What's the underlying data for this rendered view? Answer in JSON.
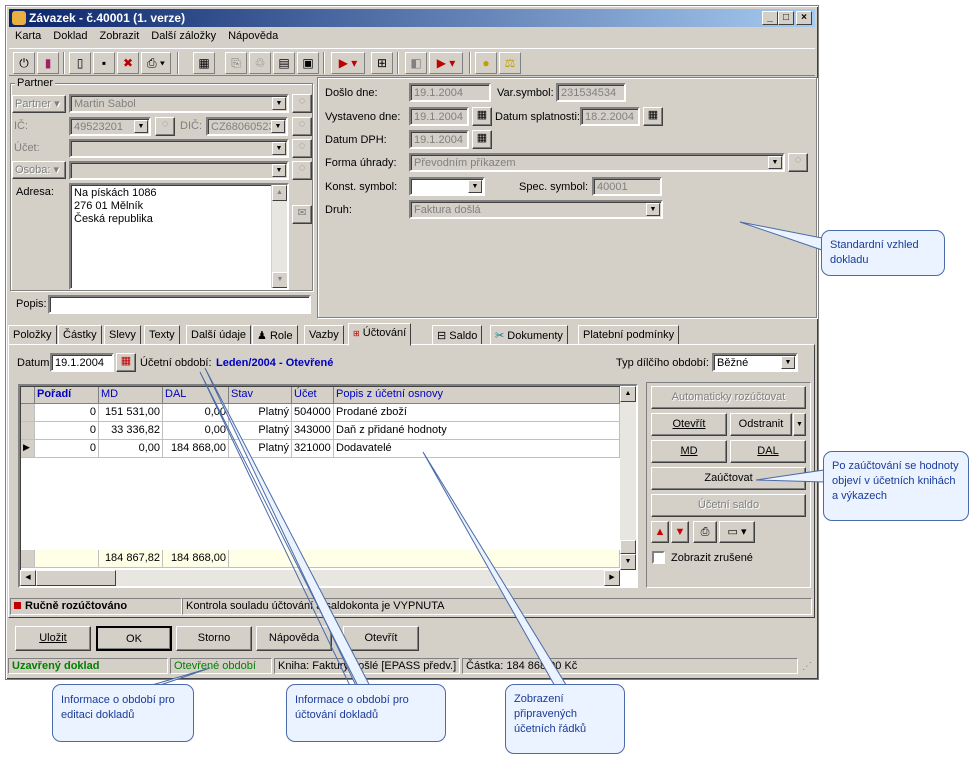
{
  "window": {
    "title": "Závazek - č.40001 (1. verze)",
    "min": "_",
    "max": "□",
    "close": "×"
  },
  "menu": [
    "Karta",
    "Doklad",
    "Zobrazit",
    "Další záložky",
    "Nápověda"
  ],
  "partner": {
    "group_label": "Partner",
    "partner_label": "Partner",
    "partner_value": "Martin Sabol",
    "ic_label": "IČ:",
    "ic_value": "49523201",
    "dic_label": "DIČ:",
    "dic_value": "CZ68060523",
    "ucet_label": "Účet:",
    "osoba_label": "Osoba:",
    "adresa_label": "Adresa:",
    "adresa": [
      "Na pískách 1086",
      "276 01 Mělník",
      "Česká republika"
    ],
    "popis_label": "Popis:"
  },
  "header": {
    "doslo_label": "Došlo dne:",
    "doslo_value": "19.1.2004",
    "varsym_label": "Var.symbol:",
    "varsym_value": "231534534",
    "vystaveno_label": "Vystaveno dne:",
    "vystaveno_value": "19.1.2004",
    "splatnost_label": "Datum splatnosti:",
    "splatnost_value": "18.2.2004",
    "dph_label": "Datum DPH:",
    "dph_value": "19.1.2004",
    "forma_label": "Forma úhrady:",
    "forma_value": "Převodním příkazem",
    "konst_label": "Konst. symbol:",
    "spec_label": "Spec. symbol:",
    "spec_value": "40001",
    "druh_label": "Druh:",
    "druh_value": "Faktura došlá"
  },
  "tabs": [
    "Položky",
    "Částky",
    "Slevy",
    "Texty",
    "Další údaje",
    "Role",
    "Vazby",
    "Účtování",
    "Saldo",
    "Dokumenty",
    "Platební podmínky"
  ],
  "accounting": {
    "datum_label": "Datum:",
    "datum_value": "19.1.2004",
    "obdobi_label": "Účetní období:",
    "obdobi_value": "Leden/2004 - Otevřené",
    "typ_label": "Typ dílčího období:",
    "typ_value": "Běžné",
    "columns": [
      "Pořadí",
      "MD",
      "DAL",
      "Stav",
      "Účet",
      "Popis z účetní osnovy"
    ],
    "rows": [
      [
        "0",
        "151 531,00",
        "0,00",
        "Platný",
        "504000",
        "Prodané zboží"
      ],
      [
        "0",
        "33 336,82",
        "0,00",
        "Platný",
        "343000",
        "Daň z přidané hodnoty"
      ],
      [
        "0",
        "0,00",
        "184 868,00",
        "Platný",
        "321000",
        "Dodavatelé"
      ]
    ],
    "totals": {
      "md": "184 867,82",
      "dal": "184 868,00"
    },
    "buttons": {
      "auto": "Automaticky rozúčtovat",
      "open": "Otevřít",
      "remove": "Odstranit",
      "md": "MD",
      "dal": "DAL",
      "post": "Zaúčtovat",
      "saldo": "Účetní saldo"
    },
    "show_cancelled": "Zobrazit zrušené",
    "status_manual": "Ručně rozúčtováno",
    "status_check": "Kontrola souladu účtování a saldokonta je VYPNUTA"
  },
  "footer_buttons": [
    "Uložit",
    "OK",
    "Storno",
    "Nápověda",
    "Otevřít"
  ],
  "statusbar": {
    "doc": "Uzavřený doklad",
    "period": "Otevřené období",
    "kniha": "Kniha: Faktury došlé [EPASS předv.]",
    "castka": "Částka: 184 868,00 Kč"
  },
  "callouts": {
    "standard": "Standardní vzhled dokladu",
    "post": "Po zaúčtování se hodnoty objeví v účetních knihách a výkazech",
    "period_edit": "Informace o období pro editaci dokladů",
    "period_post": "Informace o období pro účtování dokladů",
    "rows": "Zobrazení připravených účetních řádků"
  },
  "colors": {
    "title": "#0a246a",
    "accent_blue": "#0000c0",
    "status_green": "#008000",
    "callout_bg": "#eaf3ff"
  }
}
